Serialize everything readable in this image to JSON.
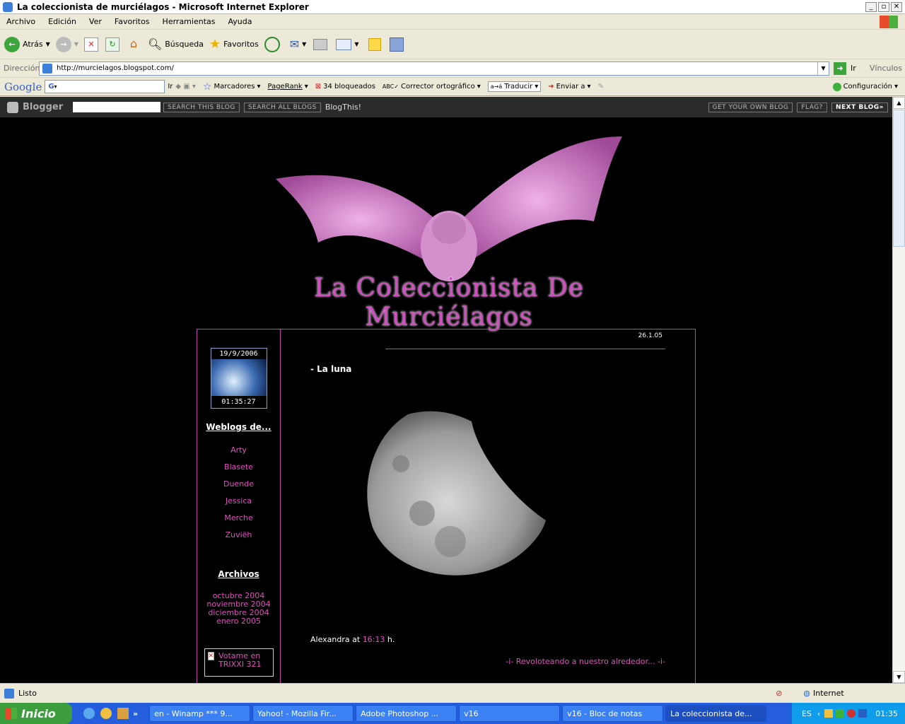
{
  "window": {
    "title": "La coleccionista de murciélagos - Microsoft Internet Explorer"
  },
  "menu": [
    "Archivo",
    "Edición",
    "Ver",
    "Favoritos",
    "Herramientas",
    "Ayuda"
  ],
  "toolbar": {
    "back": "Atrás",
    "search": "Búsqueda",
    "favorites": "Favoritos"
  },
  "address": {
    "label": "Dirección",
    "url": "http://murcielagos.blogspot.com/",
    "go": "Ir",
    "links": "Vínculos"
  },
  "google": {
    "logo": "Google",
    "go": "Ir",
    "bookmarks": "Marcadores",
    "pagerank": "PageRank",
    "blocked": "34 bloqueados",
    "spell": "Corrector ortográfico",
    "translate": "Traducir",
    "send": "Enviar a",
    "config": "Configuración"
  },
  "blogger": {
    "logo": "Blogger",
    "search_this": "SEARCH THIS BLOG",
    "search_all": "SEARCH ALL BLOGS",
    "blogthis": "BlogThis!",
    "own": "GET YOUR OWN BLOG",
    "flag": "FLAG?",
    "next": "NEXT BLOG»"
  },
  "blog": {
    "header_title": "La Coleccionista De Murciélagos",
    "clock_date": "19/9/2006",
    "clock_time": "01:35:27",
    "weblogs_title": "Weblogs de...",
    "weblogs": [
      "Arty",
      "Blasete",
      "Duende",
      "Jessica",
      "Merche",
      "Zuviëh"
    ],
    "archives_title": "Archivos",
    "archives": [
      "octubre 2004",
      "noviembre 2004",
      "diciembre 2004",
      "enero 2005"
    ],
    "vote": "Votame en TRIXXI 321",
    "post_date": "26.1.05",
    "post_title": "- La luna",
    "author_prefix": "Alexandra at",
    "post_time": "16:13",
    "author_suffix": "h.",
    "footer_link": "-i- Revoloteando a nuestro alrededor... -i-"
  },
  "status": {
    "text": "Listo",
    "zone": "Internet"
  },
  "taskbar": {
    "start": "Inicio",
    "tasks": [
      "en - Winamp *** 9...",
      "Yahoo! - Mozilla Fir...",
      "Adobe Photoshop ...",
      "v16",
      "v16 - Bloc de notas",
      "La coleccionista de..."
    ],
    "lang": "ES",
    "clock": "01:35"
  }
}
